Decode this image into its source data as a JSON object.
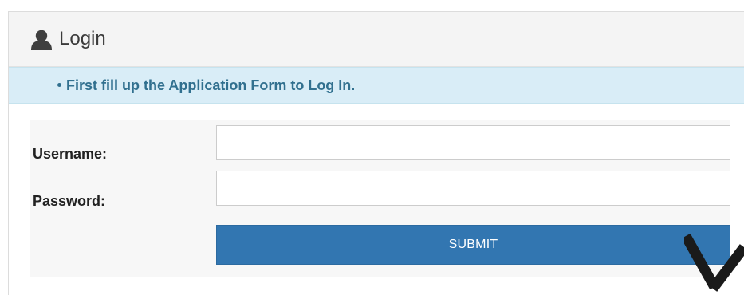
{
  "panel": {
    "title": "Login",
    "icon": "user-icon"
  },
  "alert": {
    "message": "First fill up the Application Form to Log In."
  },
  "form": {
    "username_label": "Username:",
    "username_value": "",
    "username_placeholder": "",
    "password_label": "Password:",
    "password_value": "",
    "password_placeholder": "",
    "submit_label": "SUBMIT"
  },
  "colors": {
    "heading_bg": "#f4f4f4",
    "alert_bg": "#d9edf7",
    "alert_text": "#31708f",
    "button_bg": "#3276b1",
    "form_bg": "#f7f7f7"
  }
}
